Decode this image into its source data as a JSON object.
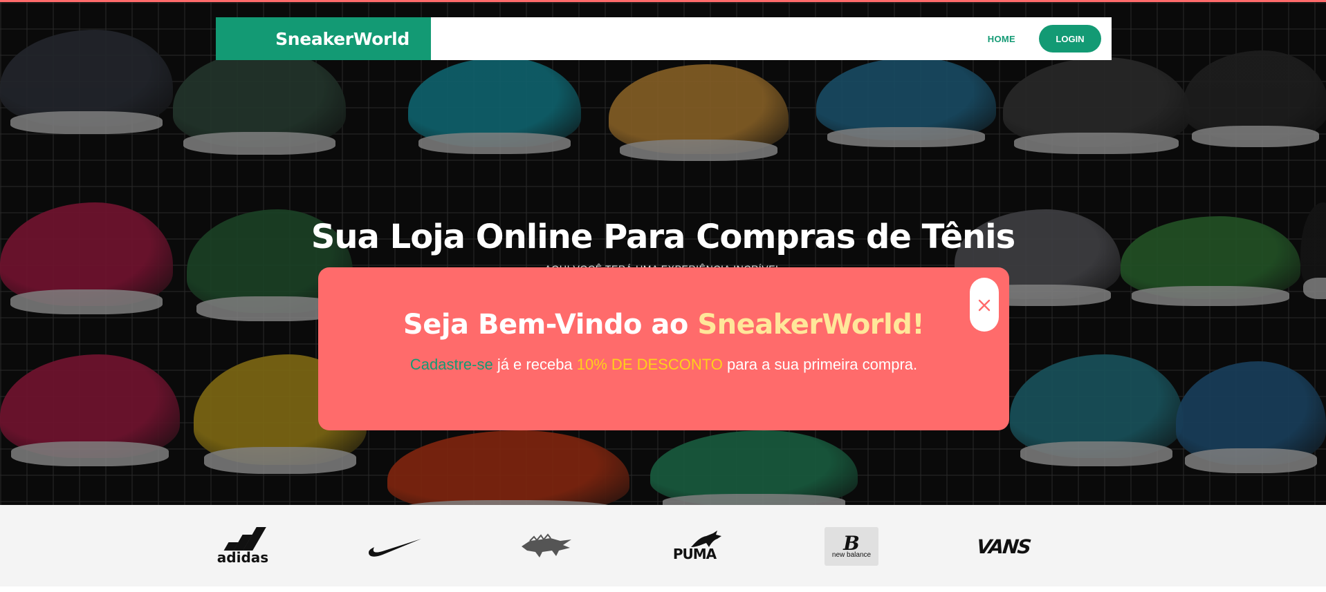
{
  "theme": {
    "primary": "#139a74",
    "accent": "#ff6b6b",
    "highlight": "#ffd11a",
    "brand_highlight": "#ffe79a"
  },
  "navbar": {
    "brand": "SneakerWorld",
    "home_label": "HOME",
    "login_label": "LOGIN"
  },
  "hero": {
    "title": "Sua Loja Online Para Compras de Tênis",
    "subtitle": "AQUI VOCÊ TERÁ UMA EXPERIÊNCIA INCRÍVEL"
  },
  "modal": {
    "title_prefix": "Seja Bem-Vindo ao ",
    "title_brand": "SneakerWorld!",
    "signup_link": "Cadastre-se",
    "text_middle": " já e receba ",
    "discount": "10% DE DESCONTO",
    "text_end": " para a sua primeira compra.",
    "close_icon": "close-icon"
  },
  "brands": [
    {
      "name": "adidas",
      "label": "adidas",
      "icon": "adidas-logo"
    },
    {
      "name": "nike",
      "icon": "nike-swoosh-logo"
    },
    {
      "name": "lacoste",
      "icon": "lacoste-crocodile-logo"
    },
    {
      "name": "puma",
      "label": "PUMA",
      "icon": "puma-logo"
    },
    {
      "name": "new balance",
      "label_big": "B",
      "label_small": "new balance",
      "icon": "new-balance-logo"
    },
    {
      "name": "vans",
      "label": "VANS",
      "icon": "vans-logo"
    }
  ]
}
